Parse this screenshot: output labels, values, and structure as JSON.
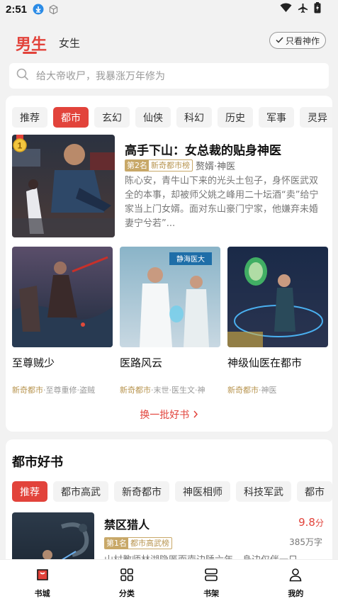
{
  "status": {
    "time": "2:51"
  },
  "header": {
    "tab_male": "男生",
    "tab_female": "女生",
    "only_god": "只看神作"
  },
  "search": {
    "placeholder": "给大帝收尸，我暴涨万年修为"
  },
  "categories": [
    "推荐",
    "都市",
    "玄幻",
    "仙侠",
    "科幻",
    "历史",
    "军事",
    "灵异"
  ],
  "top_book": {
    "title": "高手下山：女总裁的贴身神医",
    "rank": "第2名",
    "rank_list": "新奇都市榜",
    "tags": "赘婿·神医",
    "medal": "1",
    "description": "陈心安，青牛山下来的光头土包子，身怀医武双全的本事，却被师父姚之峰用二十坛酒“卖”给宁家当上门女婿。面对东山豪门宁家，他嫌弃未婚妻宁兮若”..."
  },
  "grid_books": [
    {
      "title": "至尊贼少",
      "tag_main": "新奇都市",
      "tag_rest": "·至尊重修·盗贼"
    },
    {
      "title": "医路风云",
      "tag_main": "新奇都市",
      "tag_rest": "·末世·医生文·神"
    },
    {
      "title": "神级仙医在都市",
      "tag_main": "新奇都市",
      "tag_rest": "·神医"
    }
  ],
  "grid_cover_sign": "静海医大",
  "swap_label": "换一批好书",
  "section": {
    "title": "都市好书",
    "tabs": [
      "推荐",
      "都市高武",
      "新奇都市",
      "神医相师",
      "科技军武",
      "都市"
    ]
  },
  "book2": {
    "title": "禁区猎人",
    "score": "9.8",
    "score_unit": "分",
    "rank": "第1名",
    "rank_list": "都市高武榜",
    "word_count": "385万字",
    "description": "山村教师林湖隐匿而南边陲六年，身边仅伴一只"
  },
  "bottom_nav": [
    {
      "label": "书城",
      "icon": "bookstore-icon"
    },
    {
      "label": "分类",
      "icon": "category-grid-icon"
    },
    {
      "label": "书架",
      "icon": "bookshelf-icon"
    },
    {
      "label": "我的",
      "icon": "profile-icon"
    }
  ],
  "colors": {
    "accent": "#e2433b",
    "gold": "#c8a868",
    "background": "#f2f2f2"
  }
}
